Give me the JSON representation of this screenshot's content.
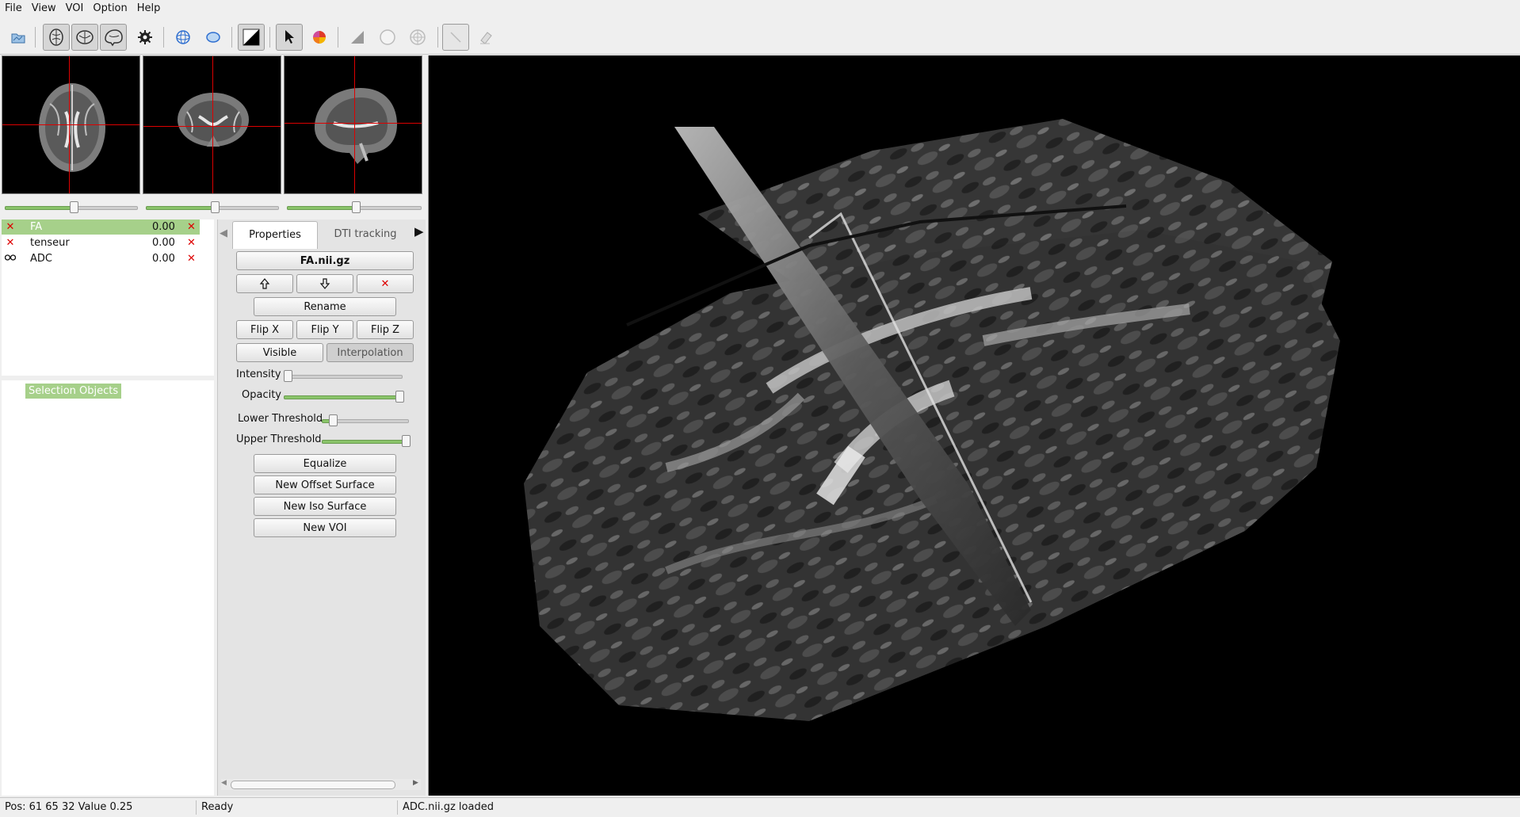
{
  "menu": [
    "File",
    "View",
    "VOI",
    "Option",
    "Help"
  ],
  "toolbar": {
    "icons": [
      "open-dataset-icon",
      "axial-view-icon",
      "coronal-view-icon",
      "sagittal-view-icon",
      "settings-gear-icon",
      "sphere-wireframe-icon",
      "ellipse-icon",
      "black-triangle-icon",
      "pointer-icon",
      "color-wheel-icon",
      "gray-triangle-icon",
      "circle-icon",
      "target-icon",
      "line-draw-icon",
      "eraser-icon"
    ]
  },
  "thumbnails": {
    "slider_levels": [
      0.5,
      0.5,
      0.5
    ]
  },
  "datasets": [
    {
      "name": "FA",
      "value": "0.00",
      "icon": "red-x-icon",
      "selected": true
    },
    {
      "name": "tenseur",
      "value": "0.00",
      "icon": "red-x-icon",
      "selected": false
    },
    {
      "name": "ADC",
      "value": "0.00",
      "icon": "glasses-icon",
      "selected": false
    }
  ],
  "selection": {
    "label": "Selection Objects"
  },
  "properties": {
    "tabs": [
      "Properties",
      "DTI tracking"
    ],
    "filename": "FA.nii.gz",
    "rename": "Rename",
    "flip_x": "Flip X",
    "flip_y": "Flip Y",
    "flip_z": "Flip Z",
    "visible": "Visible",
    "interpolation": "Interpolation",
    "intensity_label": "Intensity",
    "opacity_label": "Opacity",
    "lower_threshold_label": "Lower Threshold",
    "upper_threshold_label": "Upper Threshold",
    "intensity": 0.0,
    "opacity": 1.0,
    "lower_threshold": 0.1,
    "upper_threshold": 1.0,
    "equalize": "Equalize",
    "new_offset_surface": "New Offset Surface",
    "new_iso_surface": "New Iso Surface",
    "new_voi": "New VOI"
  },
  "status": {
    "position": "Pos: 61  65  32 Value 0.25",
    "state": "Ready",
    "message": "ADC.nii.gz loaded"
  },
  "colors": {
    "accent": "#a6d08a",
    "delete": "#dd0000",
    "crosshair": "#dd0000"
  }
}
